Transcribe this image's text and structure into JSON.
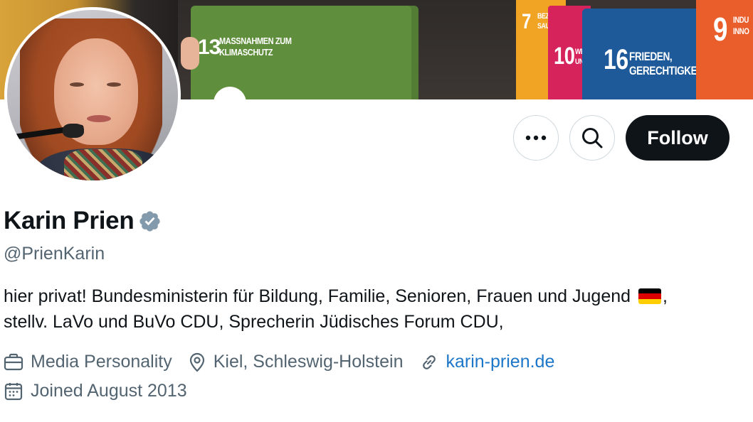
{
  "banner": {
    "sdg_13_number": "13",
    "sdg_13_text_line1": "MASSNAHMEN ZUM",
    "sdg_13_text_line2": "KLIMASCHUTZ",
    "sdg_7_number": "7",
    "sdg_7_text_line1": "BEZA",
    "sdg_7_text_line2": "SAUB",
    "sdg_10_number": "10",
    "sdg_10_text_line1": "WENI",
    "sdg_10_text_line2": "UNGL",
    "sdg_16_number": "16",
    "sdg_16_text_line1": "FRIEDEN,",
    "sdg_16_text_line2": "GERECHTIGKEIT",
    "sdg_9_number": "9",
    "sdg_9_text_line1": "INDU",
    "sdg_9_text_line2": "INNO",
    "colors": {
      "green": "#5f8f3c",
      "orange": "#f1a323",
      "pink": "#d6235c",
      "blue": "#1e5a9a",
      "red": "#ea5e2b"
    }
  },
  "actions": {
    "more_icon": "more-horizontal-icon",
    "search_icon": "search-icon",
    "follow_label": "Follow"
  },
  "profile": {
    "name": "Karin Prien",
    "verified_icon": "verified-badge-icon",
    "verified_color": "#829aab",
    "handle": "@PrienKarin",
    "bio_line1": "hier privat! Bundesministerin für Bildung, Familie, Senioren, Frauen und Jugend",
    "bio_flag": "flag-germany-icon",
    "bio_after_flag": ",",
    "bio_line2": "stellv. LaVo und BuVo CDU, Sprecherin Jüdisches Forum CDU,",
    "category_icon": "briefcase-icon",
    "category": "Media Personality",
    "location_icon": "location-pin-icon",
    "location": "Kiel, Schleswig-Holstein",
    "website_icon": "link-icon",
    "website": "karin-prien.de",
    "joined_icon": "calendar-icon",
    "joined": "Joined August 2013",
    "link_color": "#1d77c9"
  }
}
